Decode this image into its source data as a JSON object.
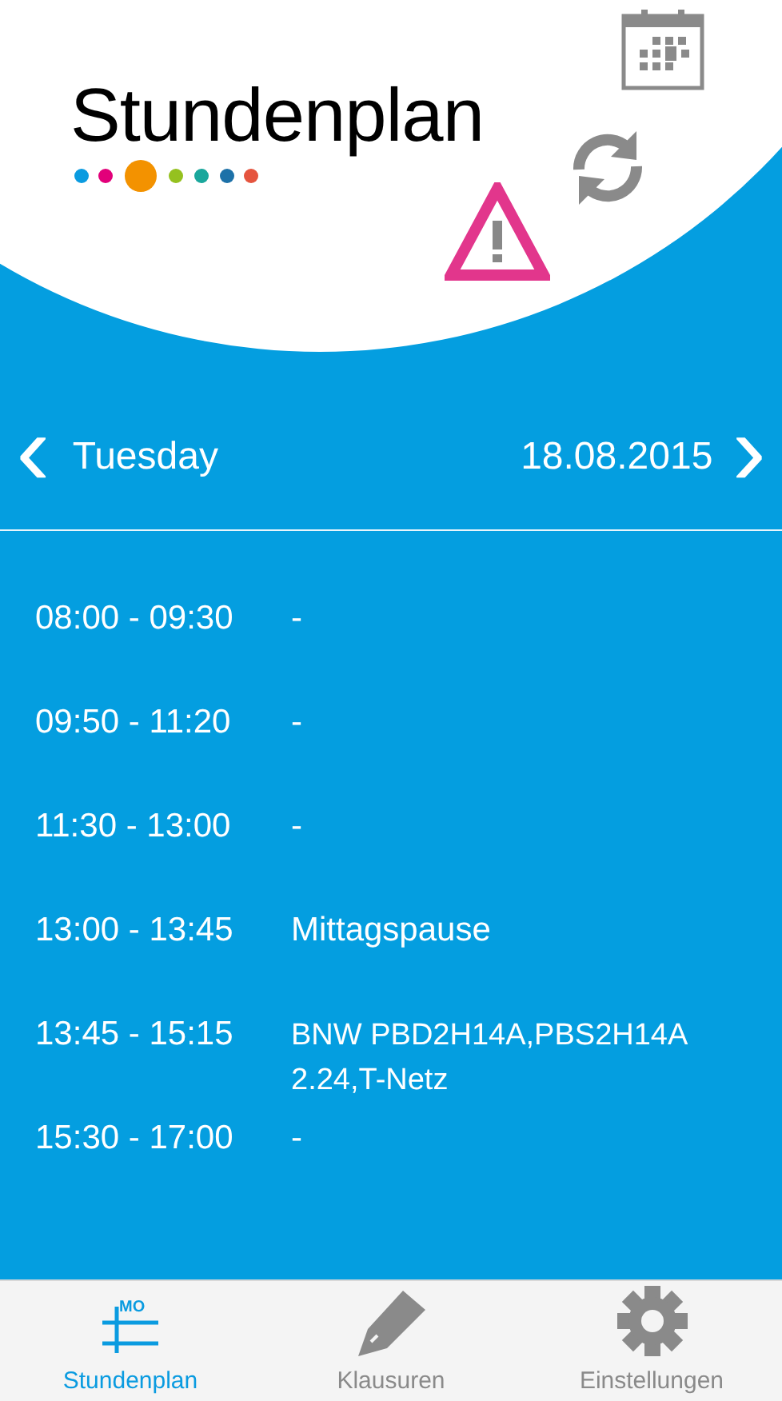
{
  "header": {
    "logo": "Stundenplan"
  },
  "day_nav": {
    "prev": "‹",
    "day": "Tuesday",
    "date": "18.08.2015",
    "next": "›"
  },
  "lessons": [
    {
      "time": "08:00 - 09:30",
      "subject": "-"
    },
    {
      "time": "09:50 - 11:20",
      "subject": "-"
    },
    {
      "time": "11:30 - 13:00",
      "subject": "-"
    },
    {
      "time": "13:00 - 13:45",
      "subject": "Mittagspause"
    },
    {
      "time": "13:45 - 15:15",
      "subject": "BNW PBD2H14A,PBS2H14A 2.24,T-Netz"
    },
    {
      "time": "15:30 - 17:00",
      "subject": "-"
    }
  ],
  "tabs": [
    {
      "kind": "timetable",
      "label": "Stundenplan",
      "icon_text": "MO",
      "selected": true
    },
    {
      "kind": "exams",
      "label": "Klausuren",
      "selected": false
    },
    {
      "kind": "settings",
      "label": "Einstellungen",
      "selected": false
    }
  ]
}
